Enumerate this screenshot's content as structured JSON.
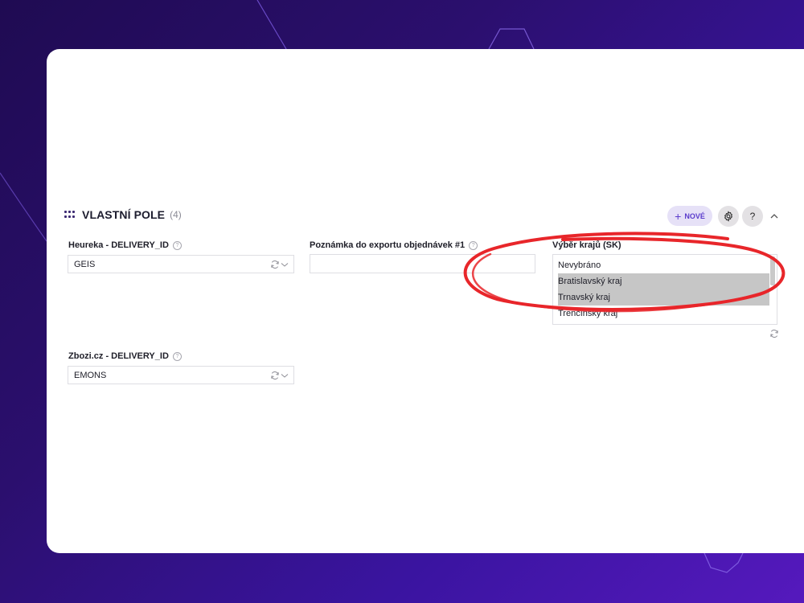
{
  "section": {
    "title": "VLASTNÍ POLE",
    "count": "(4)"
  },
  "toolbar": {
    "new_label": "NOVÉ",
    "help_label": "?"
  },
  "fields": {
    "heureka": {
      "label": "Heureka - DELIVERY_ID",
      "value": "GEIS"
    },
    "note": {
      "label": "Poznámka do exportu objednávek #1",
      "value": ""
    },
    "regions": {
      "label": "Výběr krajů (SK)",
      "options": [
        {
          "label": "Nevybráno",
          "selected": false
        },
        {
          "label": "Bratislavský kraj",
          "selected": true
        },
        {
          "label": "Trnavský kraj",
          "selected": true
        },
        {
          "label": "Trenčínský kraj",
          "selected": false
        }
      ]
    },
    "zbozi": {
      "label": "Zbozi.cz - DELIVERY_ID",
      "value": "EMONS"
    }
  },
  "icons": {
    "grip": "grip-icon",
    "help": "help-circle-icon",
    "refresh": "refresh-icon",
    "chevron_down": "chevron-down-icon",
    "chevron_up": "chevron-up-icon",
    "settings": "gear-icon",
    "plus": "plus-icon"
  },
  "colors": {
    "accent": "#5b3ccc",
    "annotation": "#e8262a",
    "selected_option": "#c6c6c6",
    "background": "#3a14a0"
  }
}
